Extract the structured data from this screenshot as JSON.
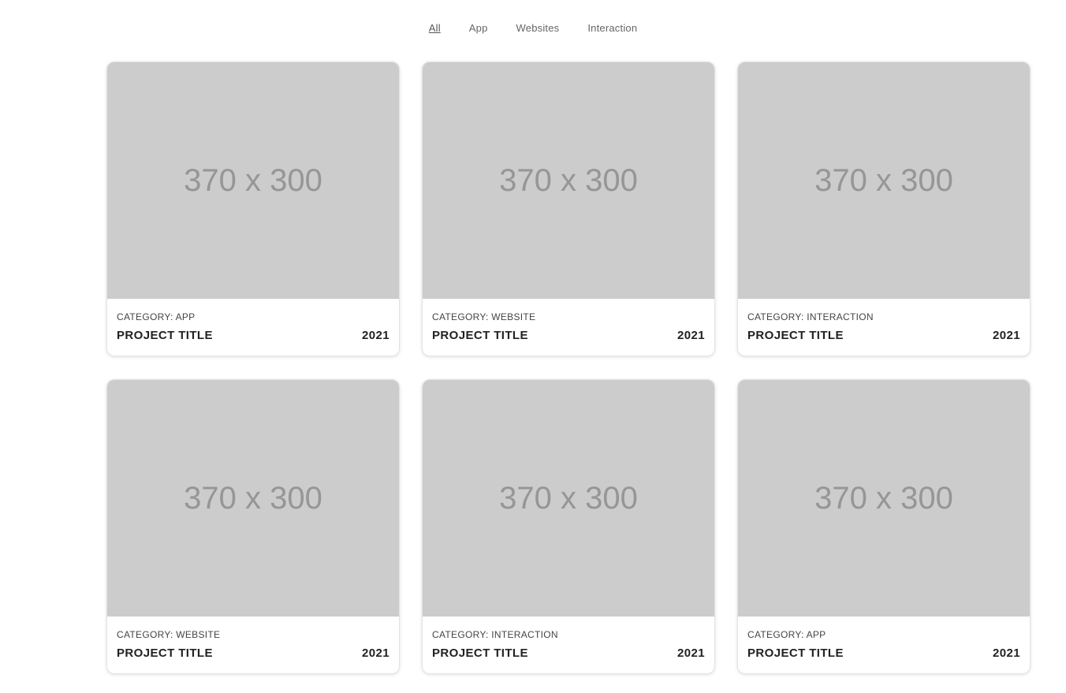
{
  "filters": [
    "All",
    "App",
    "Websites",
    "Interaction"
  ],
  "active_filter": "All",
  "cards": [
    {
      "placeholder": "370 x 300",
      "category": "CATEGORY: APP",
      "title": "PROJECT TITLE",
      "year": "2021"
    },
    {
      "placeholder": "370 x 300",
      "category": "CATEGORY: WEBSITE",
      "title": "PROJECT TITLE",
      "year": "2021"
    },
    {
      "placeholder": "370 x 300",
      "category": "CATEGORY: INTERACTION",
      "title": "PROJECT TITLE",
      "year": "2021"
    },
    {
      "placeholder": "370 x 300",
      "category": "CATEGORY: WEBSITE",
      "title": "PROJECT TITLE",
      "year": "2021"
    },
    {
      "placeholder": "370 x 300",
      "category": "CATEGORY: INTERACTION",
      "title": "PROJECT TITLE",
      "year": "2021"
    },
    {
      "placeholder": "370 x 300",
      "category": "CATEGORY: APP",
      "title": "PROJECT TITLE",
      "year": "2021"
    }
  ],
  "colors": {
    "placeholder_bg": "#cccccc",
    "placeholder_text": "#969696",
    "title_text": "#222222"
  }
}
